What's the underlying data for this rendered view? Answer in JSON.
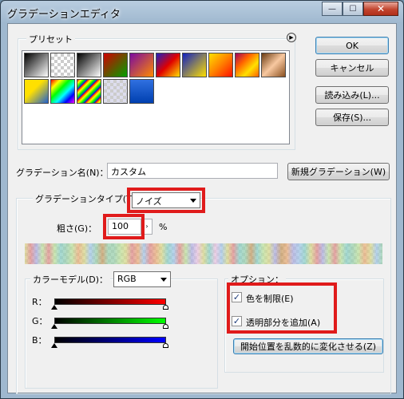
{
  "window": {
    "title": "グラデーションエディタ",
    "caption_buttons": {
      "minimize": "—",
      "maximize": "☐",
      "close": "✕"
    }
  },
  "presets": {
    "label": "プリセット",
    "menu_icon": "▶",
    "swatches": [
      "linear-gradient(135deg,#000,#fff)",
      "checker-gray",
      "linear-gradient(135deg,#000,#fff)",
      "linear-gradient(135deg,#d00000,#00a000)",
      "linear-gradient(135deg,#7a0aa0,#ff8a00)",
      "linear-gradient(135deg,#2020c0,#e00000,#ffe000)",
      "linear-gradient(135deg,#1020c0,#ffe000)",
      "linear-gradient(135deg,#ffe000,#ff8000,#ff1000)",
      "linear-gradient(135deg,#a00060,#ff6000,#ffe000,#ff6000)",
      "linear-gradient(135deg,#6a3a10,#f8c8a0,#8a5020)",
      "linear-gradient(135deg,#ffe000,#ffe000 40%,#2060d0)",
      "linear-gradient(135deg,#ff0000,#ffff00,#00ff00,#00ffff,#0000ff,#ff00ff)",
      "repeating-linear-gradient(135deg,#ff0000 0px,#ffff00 3px,#00ff00 6px,#0000ff 9px)",
      "checker-rainbow",
      "linear-gradient(180deg,#3070e0,#0040b0)"
    ]
  },
  "buttons": {
    "ok": "OK",
    "cancel": "キャンセル",
    "load": "読み込み(L)...",
    "save": "保存(S)...",
    "new_gradient": "新規グラデーション(W)",
    "randomize": "開始位置を乱数的に変化させる(Z)"
  },
  "name_field": {
    "label": "グラデーション名(N)：",
    "value": "カスタム"
  },
  "gradient_type": {
    "group_label": "グラデーションタイプ(T)：",
    "value": "ノイズ"
  },
  "roughness": {
    "label": "粗さ(G)：",
    "value": "100",
    "unit": "%"
  },
  "color_model": {
    "group_label": "カラーモデル(D)：",
    "value": "RGB",
    "channels": [
      {
        "label": "R：",
        "gradient": "linear-gradient(90deg,#000,#ff0000)",
        "min": 0,
        "max": 100
      },
      {
        "label": "G：",
        "gradient": "linear-gradient(90deg,#000,#00ff00)",
        "min": 0,
        "max": 100
      },
      {
        "label": "B：",
        "gradient": "linear-gradient(90deg,#000,#0000ff)",
        "min": 0,
        "max": 100
      }
    ]
  },
  "options": {
    "group_label": "オプション：",
    "restrict_colors": {
      "label": "色を制限(E)",
      "checked": true
    },
    "add_transparency": {
      "label": "透明部分を追加(A)",
      "checked": true
    }
  },
  "check_mark": "✓",
  "colors": {
    "highlight": "#e01b1b",
    "accent": "#3c7fb1"
  }
}
